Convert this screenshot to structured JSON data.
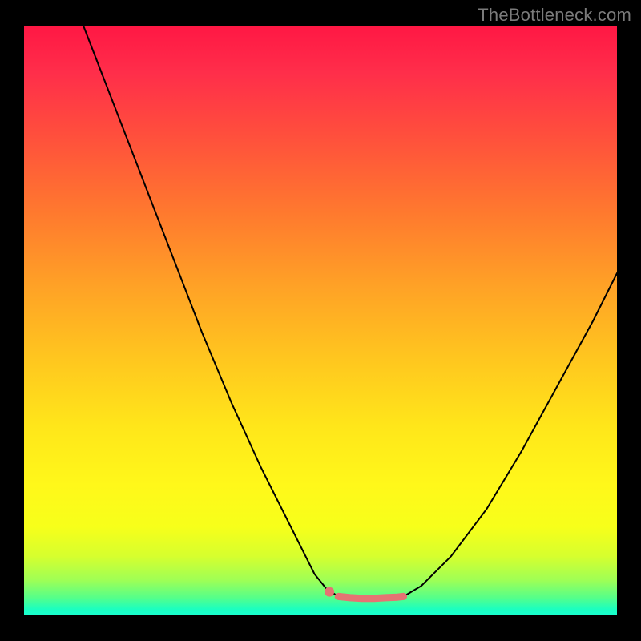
{
  "watermark": "TheBottleneck.com",
  "colors": {
    "frame": "#000000",
    "gradient_top": "#ff1744",
    "gradient_mid_upper": "#ff9a22",
    "gradient_mid": "#fff81a",
    "gradient_bottom": "#19ffd0",
    "curve": "#000000",
    "marker": "#e57373",
    "marker_dot": "#e57373"
  },
  "chart_data": {
    "type": "line",
    "title": "",
    "xlabel": "",
    "ylabel": "",
    "xlim": [
      0,
      100
    ],
    "ylim": [
      0,
      100
    ],
    "series": [
      {
        "name": "left-curve",
        "x": [
          10,
          15,
          20,
          25,
          30,
          35,
          40,
          45,
          49,
          51,
          53
        ],
        "y": [
          100,
          87,
          74,
          61,
          48,
          36,
          25,
          15,
          7,
          4.5,
          3.2
        ]
      },
      {
        "name": "right-curve",
        "x": [
          64,
          67,
          72,
          78,
          84,
          90,
          96,
          100
        ],
        "y": [
          3.2,
          5,
          10,
          18,
          28,
          39,
          50,
          58
        ]
      },
      {
        "name": "flat-bottom-marker",
        "x": [
          53,
          55,
          57,
          59,
          61,
          63,
          64
        ],
        "y": [
          3.2,
          3.0,
          2.9,
          2.9,
          3.0,
          3.1,
          3.2
        ]
      }
    ],
    "markers": [
      {
        "name": "left-dot",
        "x": 51.5,
        "y": 4.0
      }
    ]
  }
}
